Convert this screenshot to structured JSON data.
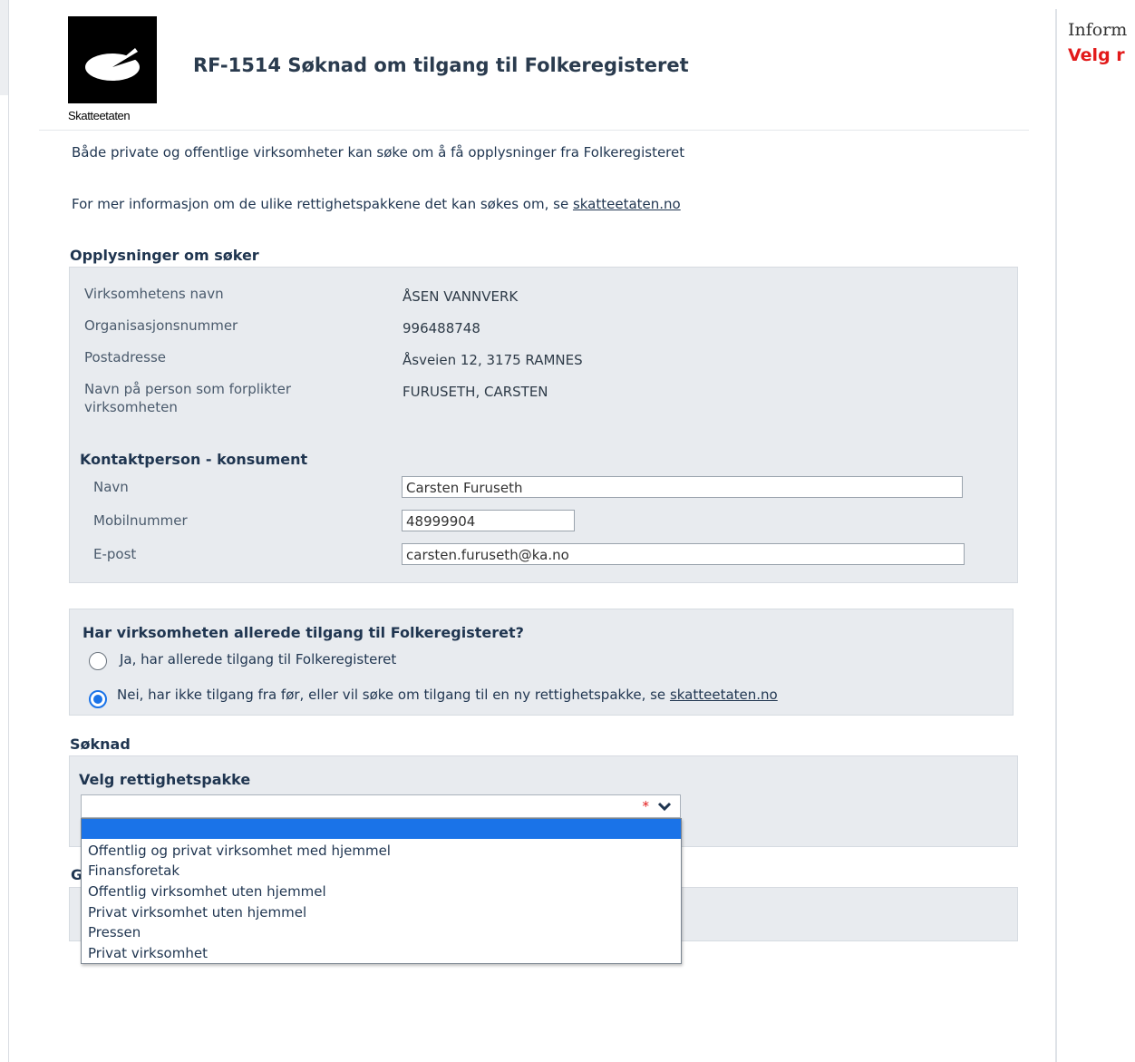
{
  "header": {
    "logo_text": "Skatteetaten",
    "title": "RF-1514 Søknad om tilgang til Folkeregisteret"
  },
  "right_panel": {
    "info_label": "Inform",
    "velg_label": "Velg r"
  },
  "intro": {
    "line1": "Både private og offentlige virksomheter kan søke om å få opplysninger fra Folkeregisteret",
    "line2_prefix": "For mer informasjon om de ulike rettighetspakkene det kan søkes om, se ",
    "line2_link": "skatteetaten.no"
  },
  "applicant": {
    "heading": "Opplysninger om søker",
    "rows": [
      {
        "label": "Virksomhetens navn",
        "value": "ÅSEN VANNVERK"
      },
      {
        "label": "Organisasjonsnummer",
        "value": "996488748"
      },
      {
        "label": "Postadresse",
        "value": "Åsveien 12, 3175 RAMNES"
      },
      {
        "label": "Navn på person som forplikter virksomheten",
        "value": "FURUSETH, CARSTEN"
      }
    ]
  },
  "contact": {
    "heading": "Kontaktperson - konsument",
    "name_label": "Navn",
    "name_value": "Carsten Furuseth",
    "mobile_label": "Mobilnummer",
    "mobile_value": "48999904",
    "email_label": "E-post",
    "email_value": "carsten.furuseth@ka.no"
  },
  "access": {
    "question": "Har virksomheten allerede tilgang til Folkeregisteret?",
    "option_yes": "Ja, har allerede tilgang til Folkeregisteret",
    "option_no_prefix": "Nei, har ikke tilgang fra før, eller vil søke om tilgang til en ny rettighetspakke, se ",
    "option_no_link": "skatteetaten.no",
    "selected": "no"
  },
  "application": {
    "heading": "Søknad",
    "package_label": "Velg rettighetspakke",
    "required_mark": "*",
    "hidden_heading_initial": "G",
    "options": [
      "",
      "Offentlig og privat virksomhet med hjemmel",
      "Finansforetak",
      "Offentlig virksomhet uten hjemmel",
      "Privat virksomhet uten hjemmel",
      "Pressen",
      "Privat virksomhet"
    ]
  },
  "colors": {
    "accent": "#1a73e8",
    "required": "#e21a1a",
    "panel_bg": "#e8ebef"
  }
}
